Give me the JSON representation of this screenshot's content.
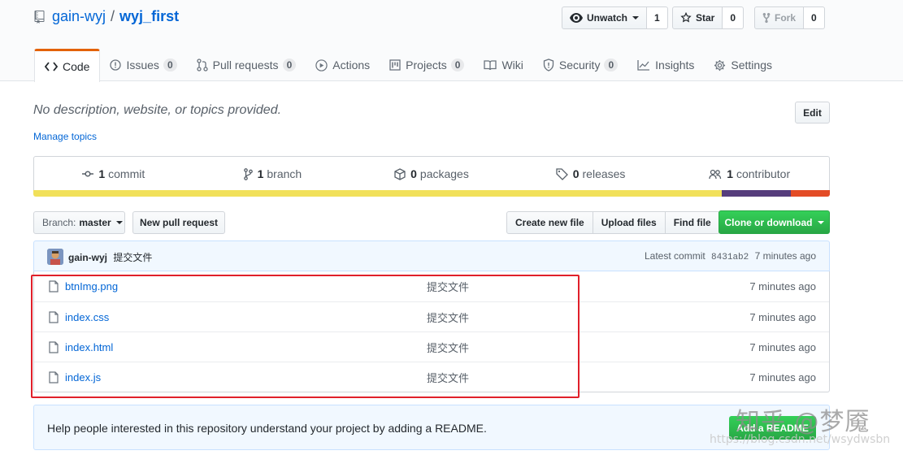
{
  "repo": {
    "owner": "gain-wyj",
    "separator": "/",
    "name": "wyj_first"
  },
  "header_buttons": {
    "watch": {
      "label": "Unwatch",
      "count": "1"
    },
    "star": {
      "label": "Star",
      "count": "0"
    },
    "fork": {
      "label": "Fork",
      "count": "0"
    }
  },
  "tabs": [
    {
      "label": "Code",
      "icon": "code-icon"
    },
    {
      "label": "Issues",
      "count": "0",
      "icon": "issue-icon"
    },
    {
      "label": "Pull requests",
      "count": "0",
      "icon": "pull-request-icon"
    },
    {
      "label": "Actions",
      "icon": "play-icon"
    },
    {
      "label": "Projects",
      "count": "0",
      "icon": "project-icon"
    },
    {
      "label": "Wiki",
      "icon": "book-icon"
    },
    {
      "label": "Security",
      "count": "0",
      "icon": "shield-icon"
    },
    {
      "label": "Insights",
      "icon": "graph-icon"
    },
    {
      "label": "Settings",
      "icon": "gear-icon"
    }
  ],
  "description": "No description, website, or topics provided.",
  "edit_label": "Edit",
  "manage_topics": "Manage topics",
  "summary": {
    "commits": {
      "count": "1",
      "label": "commit"
    },
    "branches": {
      "count": "1",
      "label": "branch"
    },
    "packages": {
      "count": "0",
      "label": "packages"
    },
    "releases": {
      "count": "0",
      "label": "releases"
    },
    "contributors": {
      "count": "1",
      "label": "contributor"
    }
  },
  "language_bar": [
    {
      "color": "#f1e05a",
      "fraction": 0.864
    },
    {
      "color": "#563d7c",
      "fraction": 0.087
    },
    {
      "color": "#e34c26",
      "fraction": 0.049
    }
  ],
  "toolbar": {
    "branch_label": "Branch:",
    "branch_value": "master",
    "new_pull_request": "New pull request",
    "create_new_file": "Create new file",
    "upload_files": "Upload files",
    "find_file": "Find file",
    "clone_or_download": "Clone or download"
  },
  "latest_commit": {
    "author": "gain-wyj",
    "message": "提交文件",
    "prefix": "Latest commit",
    "sha": "8431ab2",
    "age": "7 minutes ago"
  },
  "files": [
    {
      "name": "btnImg.png",
      "message": "提交文件",
      "age": "7 minutes ago"
    },
    {
      "name": "index.css",
      "message": "提交文件",
      "age": "7 minutes ago"
    },
    {
      "name": "index.html",
      "message": "提交文件",
      "age": "7 minutes ago"
    },
    {
      "name": "index.js",
      "message": "提交文件",
      "age": "7 minutes ago"
    }
  ],
  "readme_banner": {
    "text": "Help people interested in this repository understand your project by adding a README.",
    "button": "Add a README"
  },
  "watermark": {
    "line1": "知乎 @梦魇",
    "line2": "https://blog.csdn.net/wsydwsbn"
  }
}
